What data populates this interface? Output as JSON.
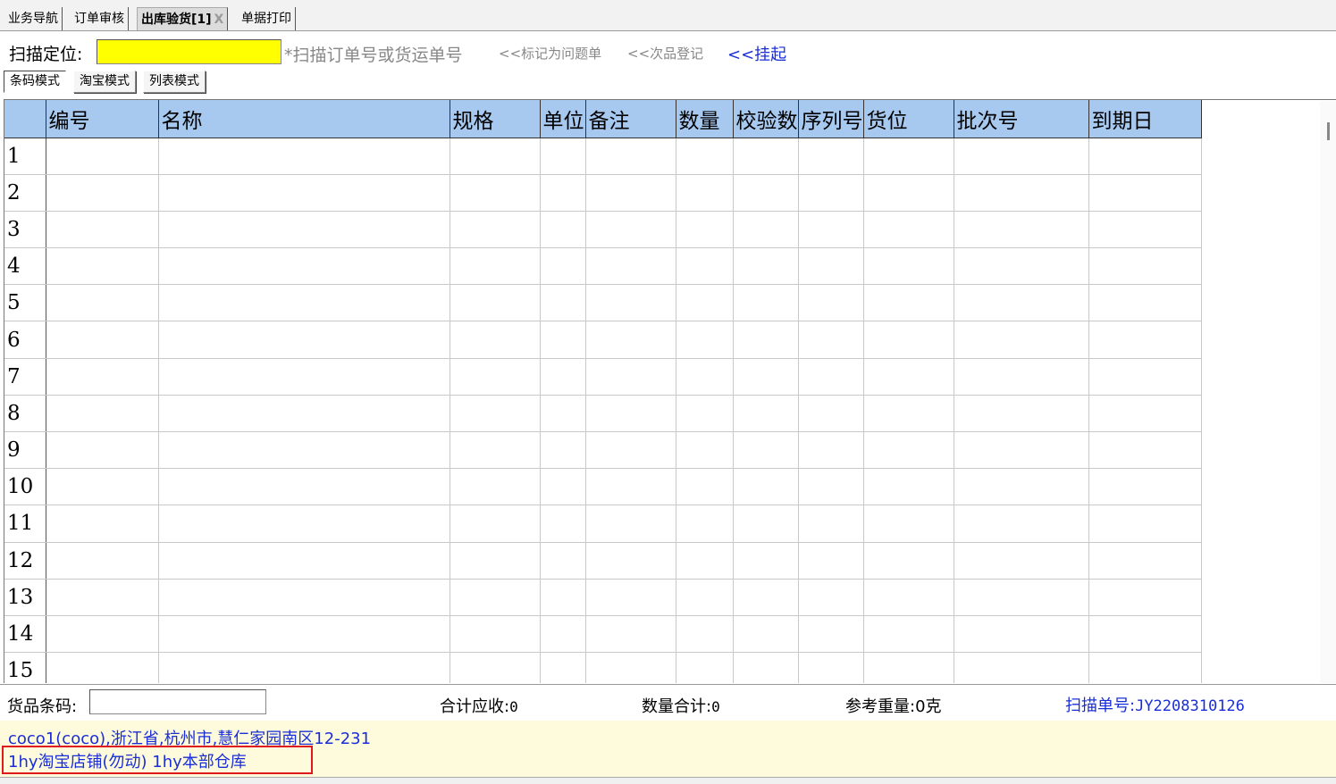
{
  "tabs": [
    {
      "label": "业务导航",
      "active": false
    },
    {
      "label": "订单审核",
      "active": false
    },
    {
      "label": "出库验货[1]",
      "active": true,
      "close": "X"
    },
    {
      "label": "单据打印",
      "active": false
    }
  ],
  "scan": {
    "label": "扫描定位:",
    "value": "",
    "hint": "*扫描订单号或货运单号",
    "mark_problem": "<<标记为问题单",
    "defect_register": "<<次品登记",
    "hang_up": "<<挂起"
  },
  "modes": [
    {
      "label": "条码模式",
      "pressed": true
    },
    {
      "label": "淘宝模式",
      "pressed": false
    },
    {
      "label": "列表模式",
      "pressed": false
    }
  ],
  "grid": {
    "columns": [
      "编号",
      "名称",
      "规格",
      "单位",
      "备注",
      "数量",
      "校验数",
      "序列号",
      "货位",
      "批次号",
      "到期日"
    ],
    "rows": [
      "1",
      "2",
      "3",
      "4",
      "5",
      "6",
      "7",
      "8",
      "9",
      "10",
      "11",
      "12",
      "13",
      "14",
      "15"
    ]
  },
  "footer": {
    "barcode_label": "货品条码:",
    "barcode_value": "",
    "total_receivable_label": "合计应收:",
    "total_receivable_value": "0",
    "qty_total_label": "数量合计:",
    "qty_total_value": "0",
    "ref_weight_label": "参考重量:",
    "ref_weight_value": "0克",
    "scan_no_label": "扫描单号:",
    "scan_no_value": "JY2208310126"
  },
  "info": {
    "address": "coco1(coco),浙江省,杭州市,慧仁家园南区12-231",
    "shop": "1hy淘宝店铺(勿动) 1hy本部仓库"
  },
  "colors": {
    "accent_blue": "#1a2ed8",
    "header_blue": "#a7c9f0",
    "scan_yellow": "#ffff00",
    "info_bg": "#fdfbdc",
    "highlight_red": "#e0191e"
  }
}
